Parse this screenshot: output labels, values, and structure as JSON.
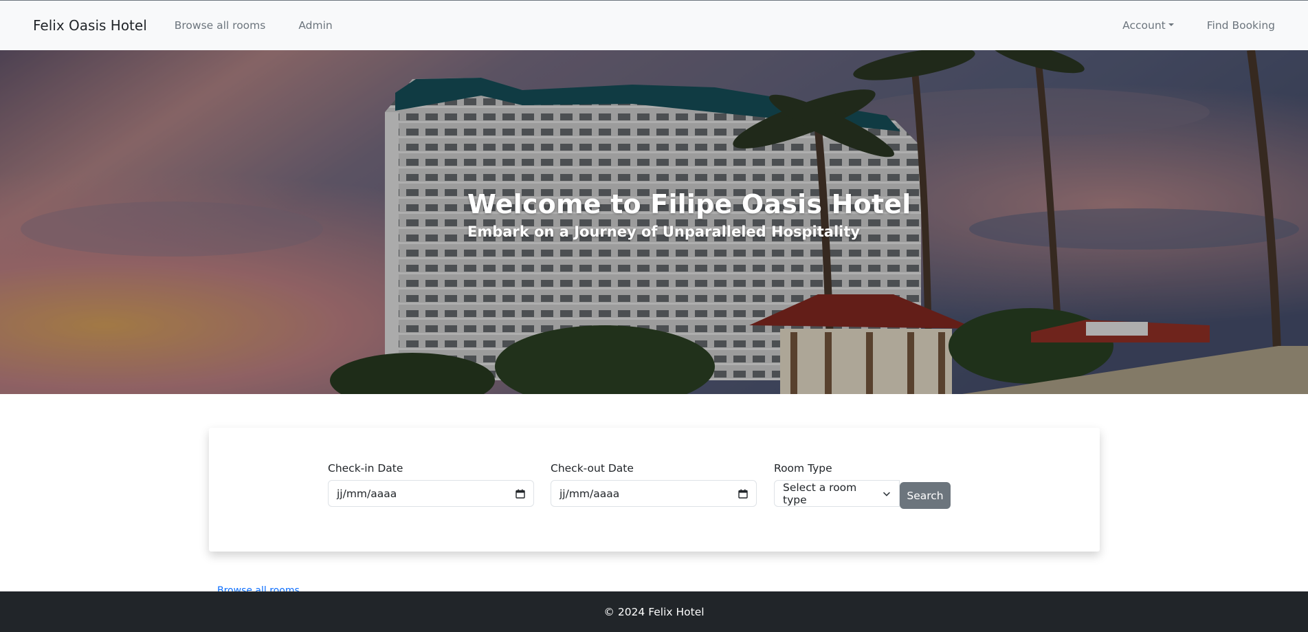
{
  "navbar": {
    "brand": "Felix Oasis Hotel",
    "links": [
      "Browse all rooms",
      "Admin"
    ],
    "right_links": {
      "account": "Account",
      "find_booking": "Find Booking"
    }
  },
  "hero": {
    "title": "Welcome to Filipe Oasis Hotel",
    "subtitle": "Embark on a Journey of Unparalleled Hospitality"
  },
  "search": {
    "checkin_label": "Check-in Date",
    "checkin_value": "jj/mm/aaaa",
    "checkout_label": "Check-out Date",
    "checkout_value": "jj/mm/aaaa",
    "room_type_label": "Room Type",
    "room_type_selected": "Select a room type",
    "button_label": "Search"
  },
  "partial_link": "Browse all rooms",
  "footer": {
    "text": "© 2024 Felix Hotel"
  },
  "colors": {
    "navbar_bg": "#f8f9fa",
    "footer_bg": "#212529",
    "button_bg": "#6c757d",
    "link": "#0d6efd"
  },
  "icons": [
    "calendar-icon",
    "chevron-down-icon",
    "caret-down-icon"
  ]
}
